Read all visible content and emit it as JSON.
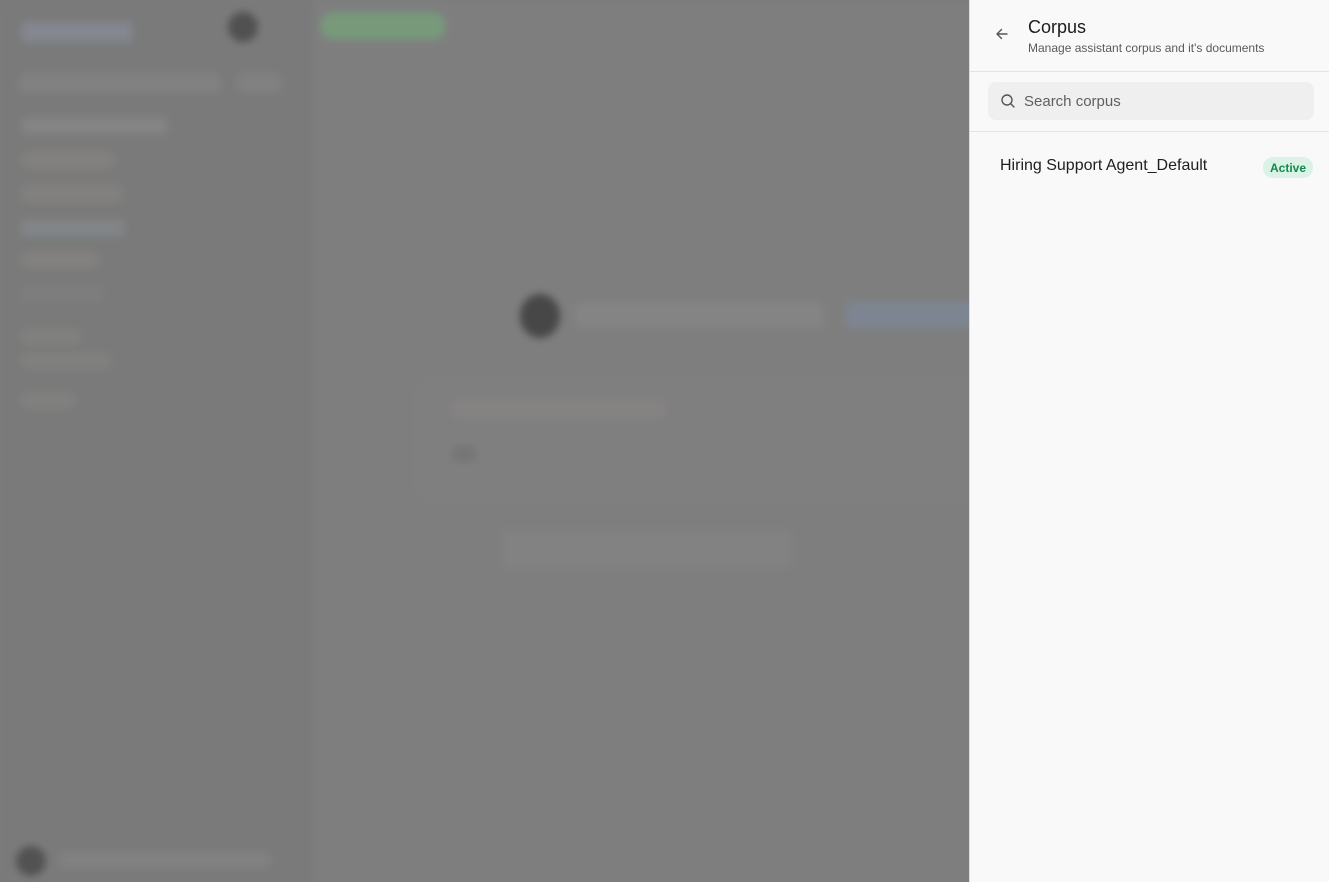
{
  "drawer": {
    "title": "Corpus",
    "subtitle": "Manage assistant corpus and it's documents",
    "search": {
      "placeholder": "Search corpus",
      "value": ""
    },
    "items": [
      {
        "name": "Hiring Support Agent_Default",
        "status": "Active"
      }
    ]
  },
  "colors": {
    "badge_bg": "#daf3e6",
    "badge_text": "#128a4c",
    "drawer_bg": "#f9f9f9"
  },
  "icons": {
    "back": "arrow-left-icon",
    "search": "search-icon"
  }
}
